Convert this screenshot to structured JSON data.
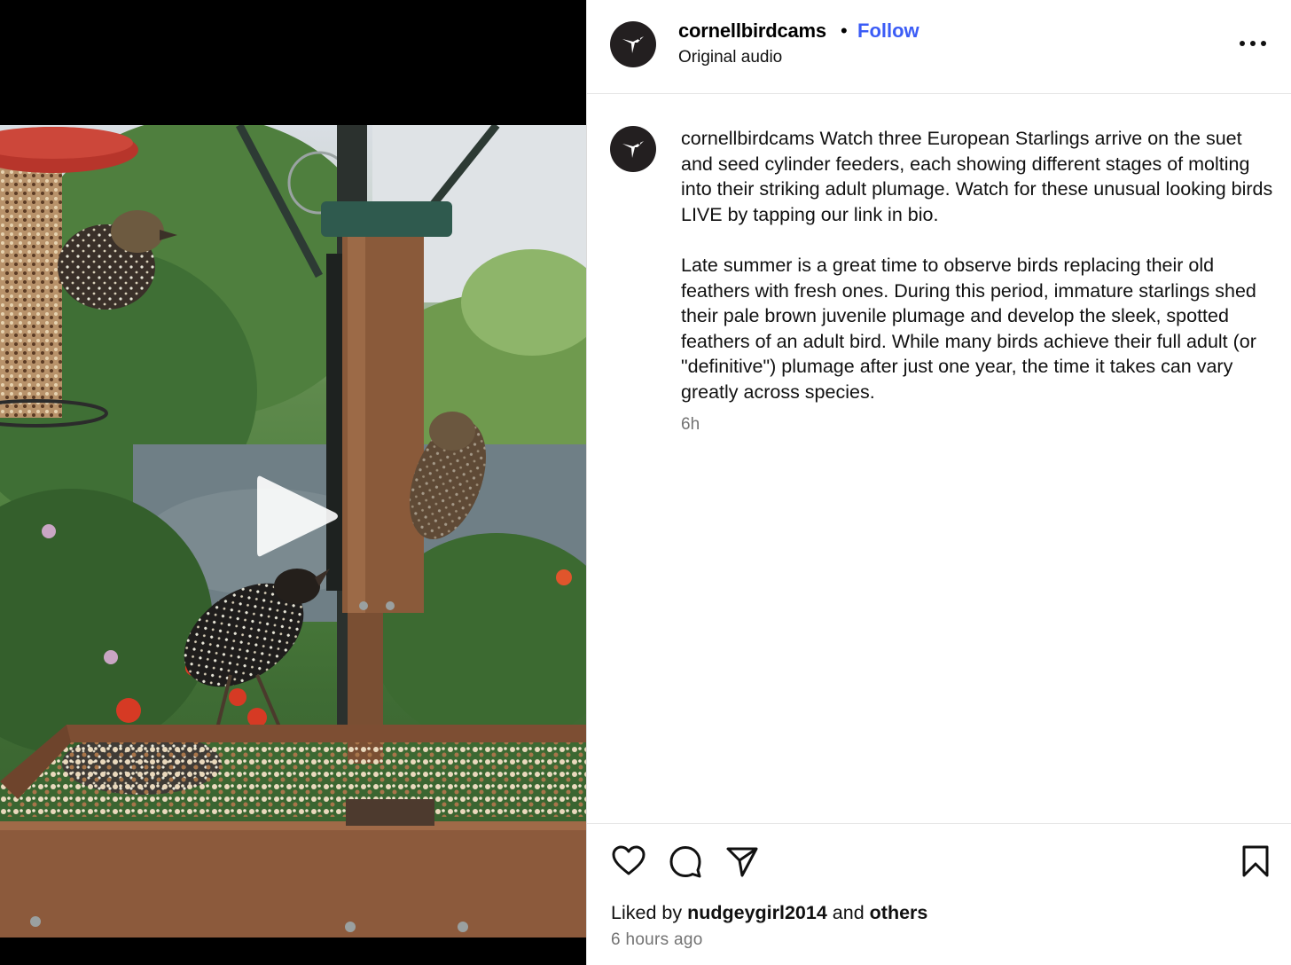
{
  "post": {
    "username": "cornellbirdcams",
    "separator": "•",
    "follow_label": "Follow",
    "audio_label": "Original audio",
    "caption_username": "cornellbirdcams",
    "caption_paragraph_1": "Watch three European Starlings arrive on the suet and seed cylinder feeders, each showing different stages of molting into their striking adult plumage. Watch for these unusual looking birds LIVE by tapping our link in bio.",
    "caption_paragraph_2": "Late summer is a great time to observe birds replacing their old feathers with fresh ones. During this period, immature starlings shed their pale brown juvenile plumage and develop the sleek, spotted feathers of an adult bird. While many birds achieve their full adult (or \"definitive\") plumage after just one year, the time it takes can vary greatly across species.",
    "caption_age": "6h"
  },
  "footer": {
    "liked_by_prefix": "Liked by",
    "liked_by_user": "nudgeygirl2014",
    "liked_by_and": "and",
    "liked_by_others": "others",
    "timestamp": "6 hours ago"
  },
  "icons": {
    "avatar": "hummingbird-logo-icon",
    "more": "more-options-icon",
    "like": "heart-icon",
    "comment": "comment-bubble-icon",
    "share": "paper-plane-icon",
    "save": "bookmark-icon",
    "play": "play-icon"
  },
  "colors": {
    "follow": "#3b5cf6",
    "avatar_bg": "#231f20",
    "muted_text": "#737373"
  }
}
